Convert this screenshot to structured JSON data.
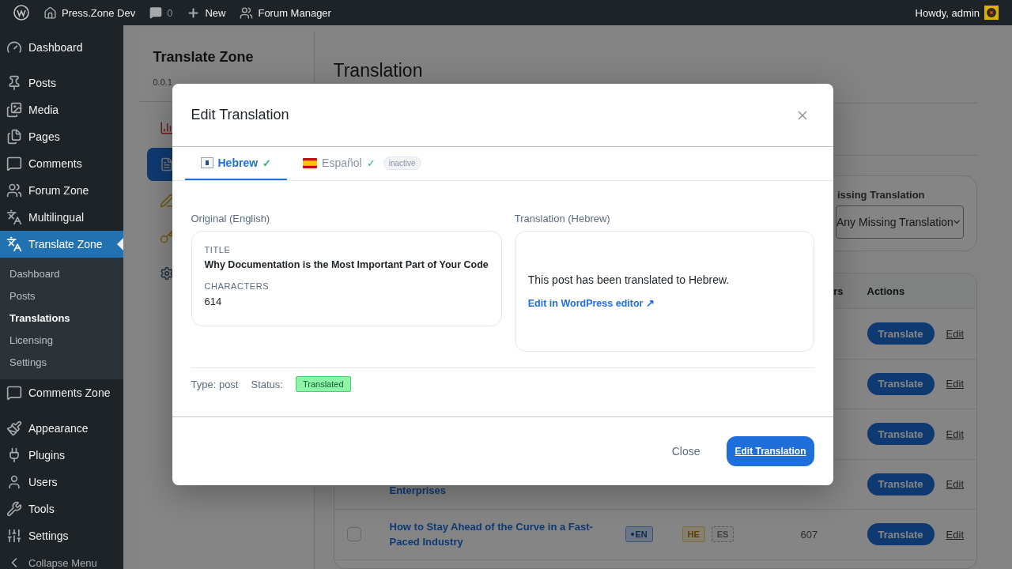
{
  "admin_bar": {
    "site": "Press.Zone Dev",
    "comments": "0",
    "new": "New",
    "forum": "Forum Manager",
    "greeting": "Howdy, admin"
  },
  "sidebar": {
    "groups": [
      [
        {
          "label": "Dashboard",
          "selected": false
        }
      ],
      [
        {
          "label": "Posts",
          "selected": false
        },
        {
          "label": "Media",
          "selected": false
        },
        {
          "label": "Pages",
          "selected": false
        },
        {
          "label": "Comments",
          "selected": false
        },
        {
          "label": "Forum Zone",
          "selected": false
        },
        {
          "label": "Multilingual",
          "selected": false
        },
        {
          "label": "Translate Zone",
          "selected": true,
          "children": [
            {
              "label": "Dashboard",
              "selected": false
            },
            {
              "label": "Posts",
              "selected": false
            },
            {
              "label": "Translations",
              "selected": true
            },
            {
              "label": "Licensing",
              "selected": false
            },
            {
              "label": "Settings",
              "selected": false
            }
          ]
        },
        {
          "label": "Comments Zone",
          "selected": false
        }
      ],
      [
        {
          "label": "Appearance",
          "selected": false
        },
        {
          "label": "Plugins",
          "selected": false
        },
        {
          "label": "Users",
          "selected": false
        },
        {
          "label": "Tools",
          "selected": false
        },
        {
          "label": "Settings",
          "selected": false
        },
        {
          "label": "Collapse Menu",
          "selected": false
        }
      ]
    ]
  },
  "plugin_panel": {
    "title": "Translate Zone",
    "version": "0.0.1",
    "items": [
      {
        "selected": false
      },
      {
        "selected": true
      },
      {
        "selected": false
      },
      {
        "selected": false
      },
      {
        "selected": false
      }
    ]
  },
  "page": {
    "title": "Translation",
    "filter": {
      "label": "issing Translation",
      "value": "Any Missing Translation"
    },
    "table": {
      "columns": [
        "rs",
        "Actions"
      ],
      "rows": [
        {
          "action": "Translate",
          "edit": "Edit"
        },
        {
          "action": "Translate",
          "edit": "Edit"
        },
        {
          "action": "Translate",
          "edit": "Edit"
        },
        {
          "title": "Enterprises",
          "action": "Translate",
          "edit": "Edit"
        },
        {
          "checked": false,
          "title": "How to Stay Ahead of the Curve in a Fast-Paced Industry",
          "source": "EN",
          "targets": [
            {
              "label": "HE",
              "translated": true
            },
            {
              "label": "ES",
              "translated": false
            }
          ],
          "characters": "607",
          "action": "Translate",
          "edit": "Edit"
        }
      ]
    }
  },
  "modal": {
    "title": "Edit Translation",
    "tabs": [
      {
        "label": "Hebrew",
        "mark": "✓",
        "selected": true
      },
      {
        "label": "Español",
        "mark": "✓",
        "selected": false,
        "badge": "inactive"
      }
    ],
    "original": {
      "heading": "Original (English)",
      "fields": [
        {
          "kind": "title",
          "label": "TITLE",
          "value": "Why Documentation is the Most Important Part of Your Code"
        },
        {
          "kind": "plain",
          "label": "CHARACTERS",
          "value": "614"
        }
      ]
    },
    "translation": {
      "heading": "Translation (Hebrew)",
      "message": "This post has been translated to Hebrew.",
      "link": "Edit in WordPress editor ↗"
    },
    "meta": {
      "type": "Type: post",
      "status_label": "Status:",
      "status": "Translated"
    },
    "buttons": [
      {
        "kind": "secondary",
        "label": "Close"
      },
      {
        "kind": "primary",
        "label": "Edit Translation"
      }
    ]
  }
}
